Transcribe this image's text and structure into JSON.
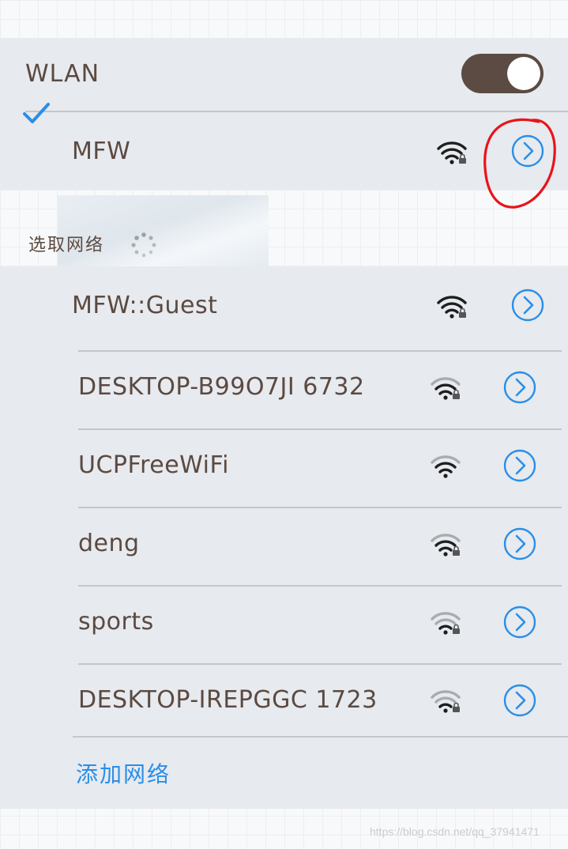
{
  "wlan": {
    "label": "WLAN",
    "enabled": true
  },
  "connected_network": {
    "ssid": "MFW",
    "status": "connected",
    "check_icon": "checkmark-icon",
    "wifi_icon": "wifi-locked-icon",
    "detail_icon": "chevron-right-circle-icon"
  },
  "section": {
    "title": "选取网络",
    "loading_icon": "spinner-icon"
  },
  "networks": [
    {
      "ssid": "MFW::Guest",
      "signal_bars": 3,
      "locked": true
    },
    {
      "ssid": "DESKTOP-B99O7JI 6732",
      "signal_bars": 2,
      "locked": true
    },
    {
      "ssid": "UCPFreeWiFi",
      "signal_bars": 2,
      "locked": false
    },
    {
      "ssid": "deng",
      "signal_bars": 2,
      "locked": true
    },
    {
      "ssid": "sports",
      "signal_bars": 1,
      "locked": true
    },
    {
      "ssid": "DESKTOP-IREPGGC 1723",
      "signal_bars": 1,
      "locked": true
    }
  ],
  "add_network": {
    "label": "添加网络"
  },
  "watermark": "https://blog.csdn.net/qq_37941471",
  "colors": {
    "accent": "#2a8ee8",
    "text": "#5b4a42",
    "panel": "#e7eaee",
    "toggle_on": "#5b4b43",
    "annotation": "#e8141b"
  }
}
